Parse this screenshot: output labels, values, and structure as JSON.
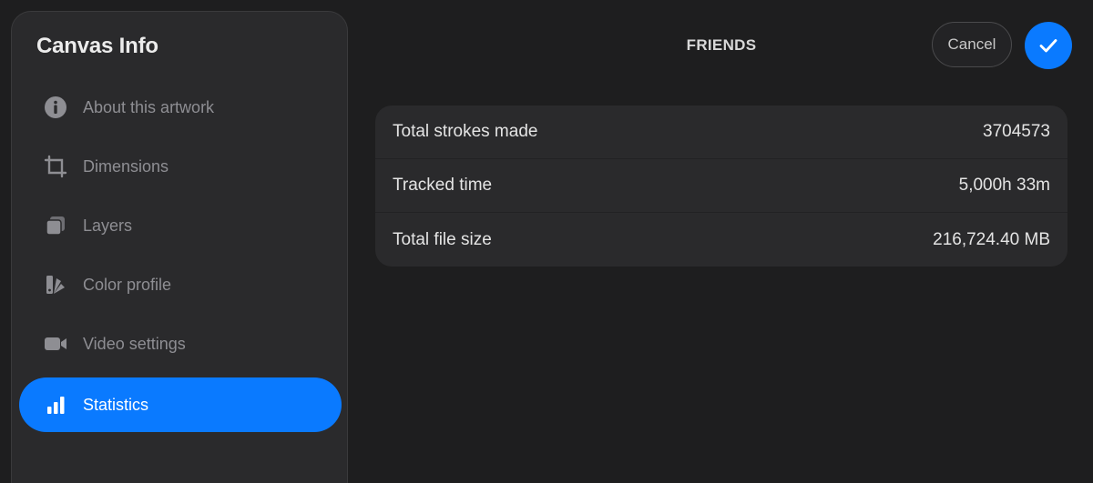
{
  "sidebar": {
    "title": "Canvas Info",
    "items": [
      {
        "label": "About this artwork",
        "icon": "info-icon",
        "active": false
      },
      {
        "label": "Dimensions",
        "icon": "crop-icon",
        "active": false
      },
      {
        "label": "Layers",
        "icon": "layers-icon",
        "active": false
      },
      {
        "label": "Color profile",
        "icon": "color-swatch-icon",
        "active": false
      },
      {
        "label": "Video settings",
        "icon": "video-camera-icon",
        "active": false
      },
      {
        "label": "Statistics",
        "icon": "bar-chart-icon",
        "active": true
      }
    ]
  },
  "header": {
    "title": "FRIENDS",
    "cancel_label": "Cancel",
    "confirm_icon": "checkmark-icon"
  },
  "stats": {
    "rows": [
      {
        "label": "Total strokes made",
        "value": "3704573"
      },
      {
        "label": "Tracked time",
        "value": "5,000h 33m"
      },
      {
        "label": "Total file size",
        "value": "216,724.40 MB"
      }
    ]
  },
  "colors": {
    "accent": "#0a7aff",
    "background": "#1e1e1f",
    "panel": "#2a2a2c",
    "muted_text": "#8e8e93"
  }
}
